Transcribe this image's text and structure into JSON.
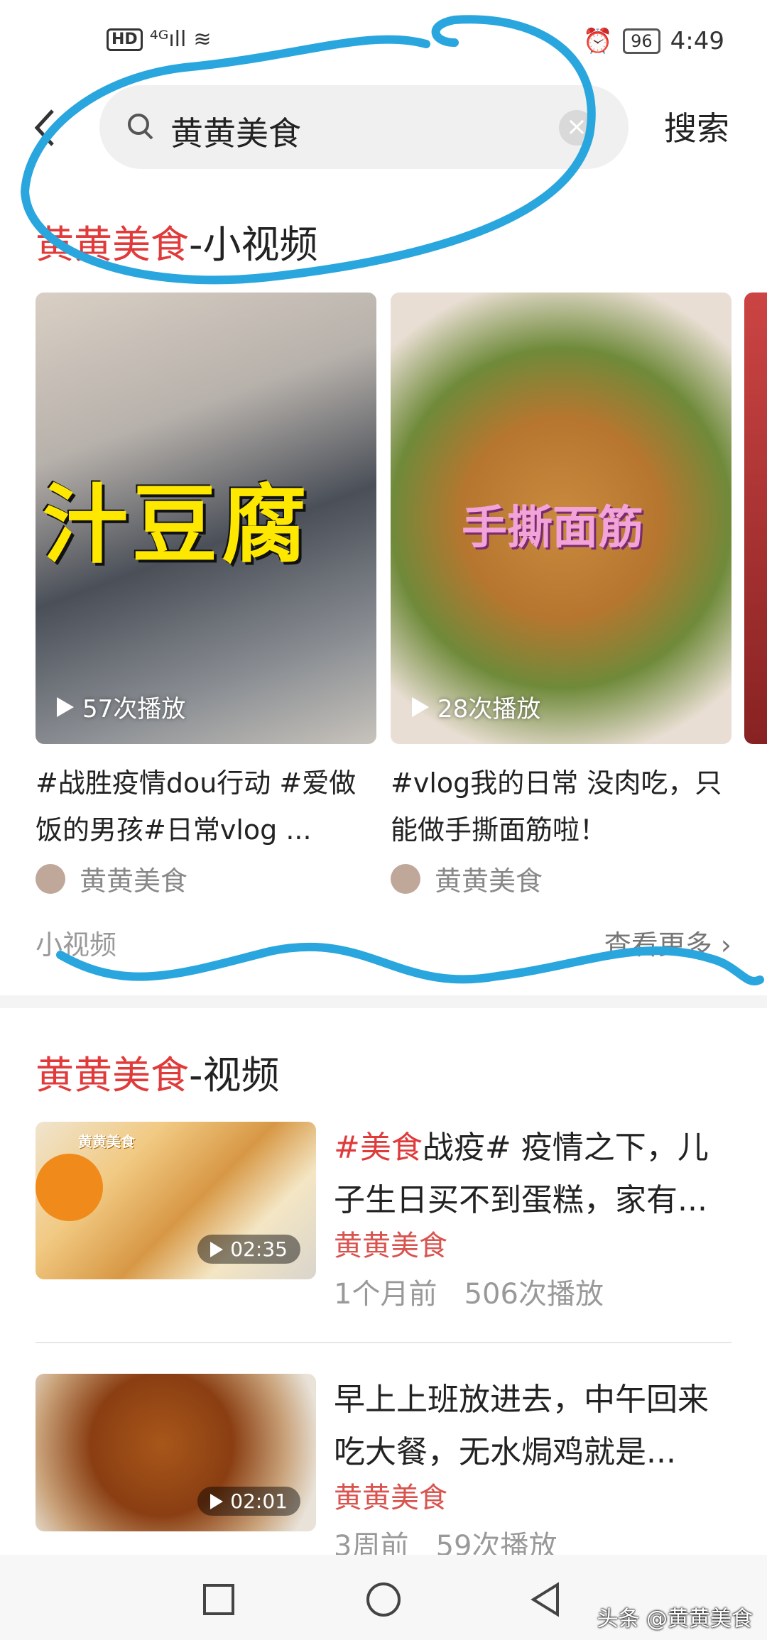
{
  "status_bar": {
    "left_icons": "HD 4G",
    "battery": "96",
    "time": "4:49"
  },
  "search": {
    "query": "黄黄美食",
    "button_label": "搜索"
  },
  "section_small": {
    "title_highlight": "黄黄美食",
    "title_rest": "-小视频"
  },
  "small_videos": [
    {
      "overlay_text": "汁豆腐",
      "plays": "57次播放",
      "desc": "#战胜疫情dou行动 #爱做饭的男孩#日常vlog ...",
      "author": "黄黄美食"
    },
    {
      "overlay_text": "手撕面筋",
      "plays": "28次播放",
      "desc": "#vlog我的日常 没肉吃，只能做手撕面筋啦！",
      "author": "黄黄美食"
    }
  ],
  "small_footer": {
    "label": "小视频",
    "more": "查看更多 ›"
  },
  "section_video": {
    "title_highlight": "黄黄美食",
    "title_rest": "-视频"
  },
  "videos": [
    {
      "title_tag": "#美食",
      "title_rest": "战疫# 疫情之下，儿子生日买不到蛋糕，家有...",
      "author": "黄黄美食",
      "age": "1个月前",
      "plays": "506次播放",
      "duration": "02:35",
      "thumb_label": "黄黄美食"
    },
    {
      "title_tag": "",
      "title_rest": "早上上班放进去，中午回来吃大餐，无水焗鸡就是...",
      "author": "黄黄美食",
      "age": "3周前",
      "plays": "59次播放",
      "duration": "02:01"
    }
  ],
  "watermark": "头条 @黄黄美食",
  "colors": {
    "accent": "#e03a3a",
    "annotation": "#2aa6de"
  }
}
